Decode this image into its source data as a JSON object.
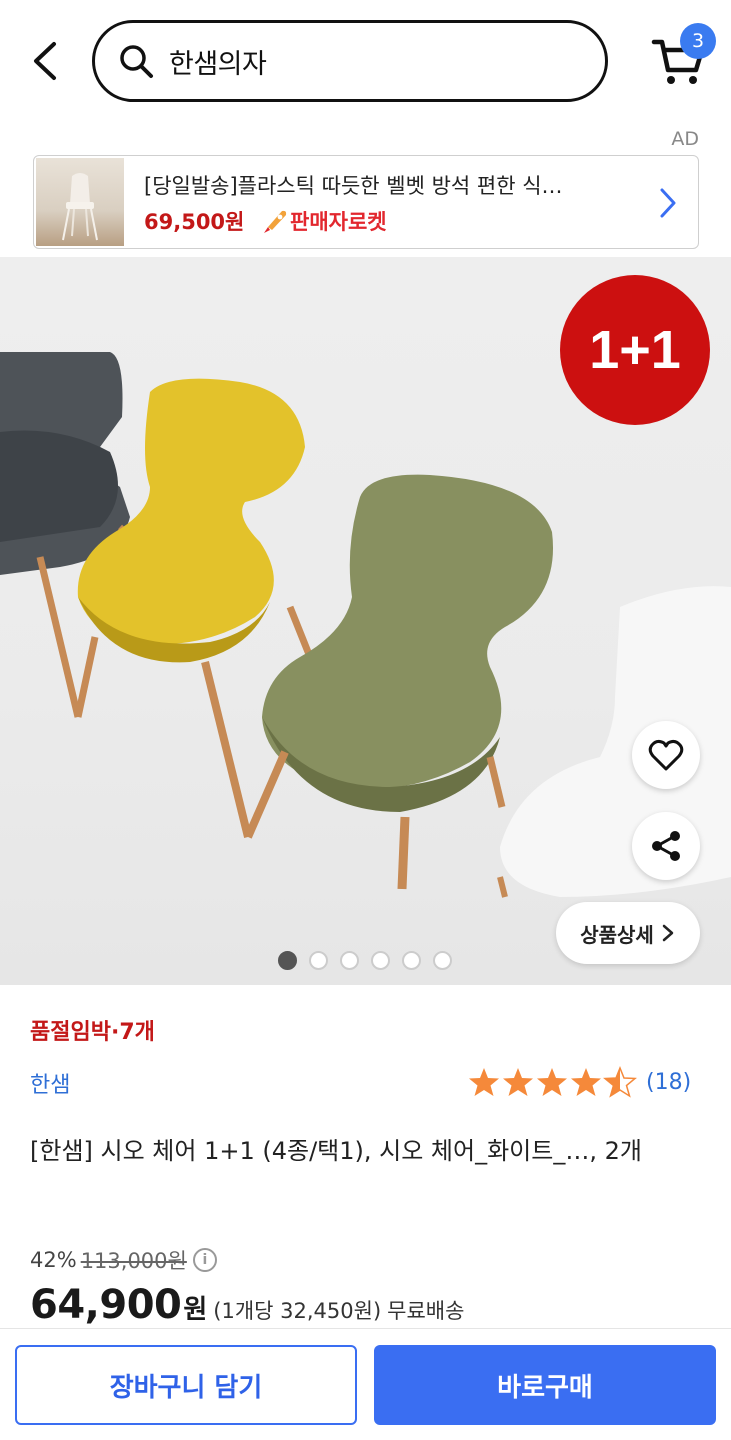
{
  "header": {
    "search_query": "한샘의자",
    "cart_count": "3"
  },
  "ad": {
    "label": "AD",
    "title": "[당일발송]플라스틱 따듯한 벨벳 방석 편한 식…",
    "price": "69,500원",
    "badge": "판매자로켓"
  },
  "hero": {
    "promo_badge": "1+1",
    "detail_button": "상품상세",
    "slide_count": 6,
    "active_slide": 1
  },
  "product": {
    "stock_status": "품절임박·7개",
    "brand": "한샘",
    "rating": 4.5,
    "rating_count": "(18)",
    "title": "[한샘] 시오 체어 1+1 (4종/택1), 시오 체어_화이트_…, 2개",
    "discount": "42%",
    "original_price": "113,000원",
    "price": "64,900",
    "price_unit": "원",
    "unit_price": "(1개당 32,450원)",
    "shipping": "무료배송"
  },
  "bottom": {
    "cart_button": "장바구니 담기",
    "buy_button": "바로구매"
  },
  "colors": {
    "accent_blue": "#3a6ef2",
    "sale_red": "#c31818",
    "star_orange": "#f5893a"
  }
}
